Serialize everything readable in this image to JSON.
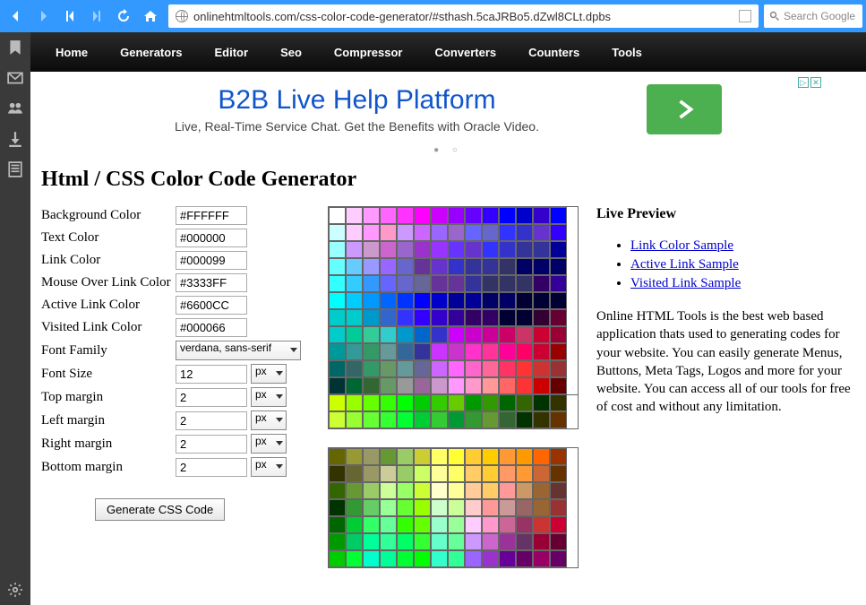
{
  "url": "onlinehtmltools.com/css-color-code-generator/#sthash.5caJRBo5.dZwl8CLt.dpbs",
  "search_placeholder": "Search Google",
  "nav": [
    "Home",
    "Generators",
    "Editor",
    "Seo",
    "Compressor",
    "Converters",
    "Counters",
    "Tools"
  ],
  "ad": {
    "title": "B2B Live Help Platform",
    "sub": "Live, Real-Time Service Chat. Get the Benefits with Oracle Video."
  },
  "page_title": "Html / CSS Color Code Generator",
  "form": {
    "rows": [
      {
        "label": "Background Color",
        "value": "#FFFFFF",
        "type": "text"
      },
      {
        "label": "Text Color",
        "value": "#000000",
        "type": "text"
      },
      {
        "label": "Link Color",
        "value": "#000099",
        "type": "text"
      },
      {
        "label": "Mouse Over Link Color",
        "value": "#3333FF",
        "type": "text"
      },
      {
        "label": "Active Link Color",
        "value": "#6600CC",
        "type": "text"
      },
      {
        "label": "Visited Link Color",
        "value": "#000066",
        "type": "text"
      },
      {
        "label": "Font Family",
        "value": "verdana, sans-serif",
        "type": "select"
      },
      {
        "label": "Font Size",
        "value": "12",
        "unit": "px",
        "type": "text-unit"
      },
      {
        "label": "Top margin",
        "value": "2",
        "unit": "px",
        "type": "text-unit"
      },
      {
        "label": "Left margin",
        "value": "2",
        "unit": "px",
        "type": "text-unit"
      },
      {
        "label": "Right margin",
        "value": "2",
        "unit": "px",
        "type": "text-unit"
      },
      {
        "label": "Bottom margin",
        "value": "2",
        "unit": "px",
        "type": "text-unit"
      }
    ],
    "button": "Generate CSS Code"
  },
  "preview": {
    "title": "Live Preview",
    "links": [
      "Link Color Sample",
      "Active Link Sample",
      "Visited Link Sample"
    ],
    "desc": "Online HTML Tools is the best web based application thats used to generating codes for your website. You can easily generate Menus, Buttons, Meta Tags, Logos and more for your website. You can access all of our tools for free of cost and without any limitation."
  },
  "palette1": [
    [
      "#ffffff",
      "#ffccff",
      "#ff99ff",
      "#ff66ff",
      "#ff33ff",
      "#ff00ff",
      "#cc00ff",
      "#9900ff",
      "#6600ff",
      "#3300ff",
      "#0000ff",
      "#0000cc",
      "#3300cc",
      "#0000ff"
    ],
    [
      "#ccffff",
      "#ffccff",
      "#ff99ff",
      "#ff99cc",
      "#cc99ff",
      "#cc66ff",
      "#9966ff",
      "#9966cc",
      "#6666ff",
      "#6666cc",
      "#3333ff",
      "#3333cc",
      "#6633cc",
      "#3300ff"
    ],
    [
      "#99ffff",
      "#cc99ff",
      "#cc99cc",
      "#cc66cc",
      "#9966cc",
      "#9933cc",
      "#9933ff",
      "#6633ff",
      "#6633cc",
      "#3333ff",
      "#3333cc",
      "#333399",
      "#333399",
      "#000099"
    ],
    [
      "#66ffff",
      "#66ccff",
      "#9999ff",
      "#9966ff",
      "#6666cc",
      "#663399",
      "#6633cc",
      "#3333cc",
      "#333399",
      "#333399",
      "#333366",
      "#000066",
      "#000066",
      "#000066"
    ],
    [
      "#33ffff",
      "#33ccff",
      "#3399ff",
      "#6666ff",
      "#6666cc",
      "#666699",
      "#663399",
      "#663399",
      "#333399",
      "#333366",
      "#333366",
      "#333366",
      "#330066",
      "#330099"
    ],
    [
      "#00ffff",
      "#00ccff",
      "#0099ff",
      "#0066ff",
      "#0033ff",
      "#0000ff",
      "#0000cc",
      "#000099",
      "#000099",
      "#000066",
      "#000066",
      "#000033",
      "#000033",
      "#000033"
    ],
    [
      "#00cccc",
      "#00cccc",
      "#0099cc",
      "#3366cc",
      "#3333ff",
      "#3300ff",
      "#3300cc",
      "#330099",
      "#330066",
      "#330066",
      "#000033",
      "#000033",
      "#330033",
      "#660033"
    ],
    [
      "#00cccc",
      "#00cc99",
      "#33cc99",
      "#33cccc",
      "#0099cc",
      "#0066cc",
      "#3333cc",
      "#cc00ff",
      "#cc00cc",
      "#cc0099",
      "#cc0066",
      "#cc3366",
      "#cc0033",
      "#990033"
    ],
    [
      "#009999",
      "#339999",
      "#339966",
      "#669999",
      "#336699",
      "#333399",
      "#cc33ff",
      "#cc33cc",
      "#ff33cc",
      "#ff3399",
      "#ff0099",
      "#ff0066",
      "#cc0033",
      "#990000"
    ],
    [
      "#006666",
      "#336666",
      "#339966",
      "#669966",
      "#669999",
      "#666699",
      "#cc66ff",
      "#ff66ff",
      "#ff66cc",
      "#ff6699",
      "#ff3366",
      "#ff3333",
      "#cc3333",
      "#993333"
    ],
    [
      "#003333",
      "#006633",
      "#336633",
      "#669966",
      "#999999",
      "#996699",
      "#cc99cc",
      "#ff99ff",
      "#ff99cc",
      "#ff9999",
      "#ff6666",
      "#ff3333",
      "#cc0000",
      "#660000"
    ]
  ],
  "palette1b": [
    [
      "#ccff00",
      "#99ff00",
      "#66ff00",
      "#33ff00",
      "#00ff00",
      "#00cc00",
      "#33cc00",
      "#66cc00",
      "#009900",
      "#339900",
      "#006600",
      "#336600",
      "#003300",
      "#333300"
    ],
    [
      "#ccff33",
      "#99ff33",
      "#66ff33",
      "#33ff33",
      "#00ff33",
      "#00cc33",
      "#33cc33",
      "#009933",
      "#339933",
      "#669933",
      "#336633",
      "#003300",
      "#333300",
      "#663300"
    ]
  ],
  "palette2": [
    [
      "#666600",
      "#999933",
      "#999966",
      "#669933",
      "#99cc66",
      "#cccc33",
      "#ffff66",
      "#ffff33",
      "#ffcc33",
      "#ffcc00",
      "#ff9933",
      "#ff9900",
      "#ff6600",
      "#993300"
    ],
    [
      "#333300",
      "#666633",
      "#999966",
      "#cccc99",
      "#99cc66",
      "#ccff66",
      "#ffff99",
      "#ffff66",
      "#ffcc66",
      "#ffcc33",
      "#ff9966",
      "#ff9933",
      "#cc6633",
      "#663300"
    ],
    [
      "#336600",
      "#669933",
      "#99cc66",
      "#ccff99",
      "#99ff66",
      "#ccff33",
      "#ffffcc",
      "#ffff99",
      "#ffcc99",
      "#ffcc66",
      "#ff9999",
      "#cc9966",
      "#996633",
      "#663333"
    ],
    [
      "#003300",
      "#339933",
      "#66cc66",
      "#99ff99",
      "#66ff33",
      "#99ff00",
      "#ccffcc",
      "#ccff99",
      "#ffcccc",
      "#ff9999",
      "#cc9999",
      "#996666",
      "#996633",
      "#993333"
    ],
    [
      "#006600",
      "#00cc33",
      "#33ff66",
      "#66ff99",
      "#33ff00",
      "#66ff00",
      "#99ffcc",
      "#99ff99",
      "#ffccff",
      "#ff99cc",
      "#cc6699",
      "#993366",
      "#cc3333",
      "#cc0033"
    ],
    [
      "#009900",
      "#00cc66",
      "#00ff99",
      "#33ff99",
      "#00ff66",
      "#33ff33",
      "#66ffcc",
      "#66ff99",
      "#cc99ff",
      "#cc66cc",
      "#993399",
      "#663366",
      "#990033",
      "#660033"
    ],
    [
      "#00cc00",
      "#00ff33",
      "#00ffcc",
      "#00ff99",
      "#00ff33",
      "#00ff00",
      "#33ffcc",
      "#33ff99",
      "#9966ff",
      "#9933cc",
      "#660099",
      "#660066",
      "#990066",
      "#660066"
    ]
  ]
}
